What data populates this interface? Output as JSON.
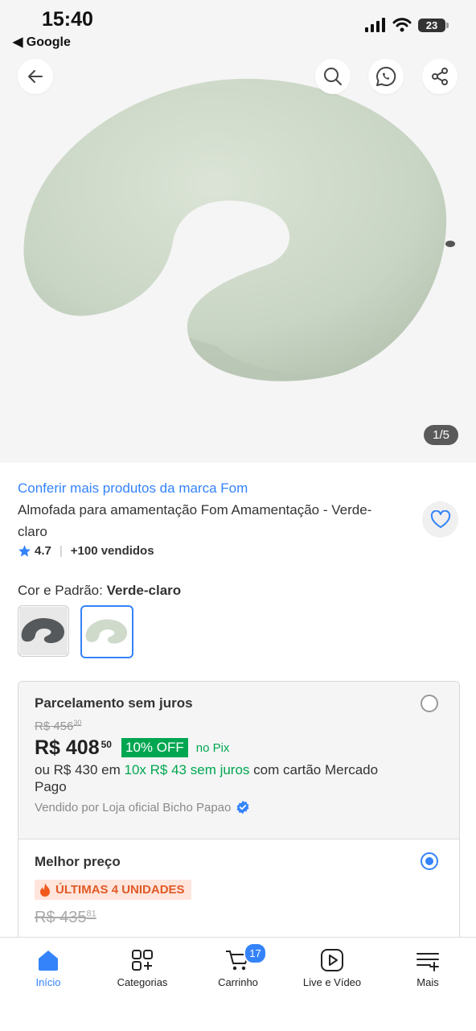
{
  "status": {
    "time": "15:40",
    "back_app": "◀ Google",
    "battery": "23"
  },
  "gallery": {
    "counter": "1/5"
  },
  "product": {
    "brand_link": "Conferir mais produtos da marca Fom",
    "title": "Almofada para amamentação Fom Amamentação - Verde-claro",
    "rating": "4.7",
    "sold": "+100 vendidos",
    "color_label": "Cor e Padrão: ",
    "color_value": "Verde-claro"
  },
  "option1": {
    "title": "Parcelamento sem juros",
    "old_price": "R$ 456",
    "old_cents": "30",
    "price": "R$ 408",
    "cents": "50",
    "off": "10% OFF",
    "pix": "no Pix",
    "install_prefix": "ou R$ 430 em ",
    "install_green": "10x R$ 43 sem juros",
    "install_suffix": " com cartão Mercado Pago",
    "seller": "Vendido por Loja oficial Bicho Papao"
  },
  "option2": {
    "title": "Melhor preço",
    "badge": "ÚLTIMAS 4 UNIDADES",
    "old_price": "R$ 435",
    "old_cents": "81"
  },
  "nav": {
    "home": "Início",
    "categories": "Categorias",
    "cart": "Carrinho",
    "cart_count": "17",
    "live": "Live e Vídeo",
    "more": "Mais"
  },
  "colors": {
    "accent": "#3483fa",
    "green": "#00a650",
    "pillow": "#cfdacb"
  }
}
